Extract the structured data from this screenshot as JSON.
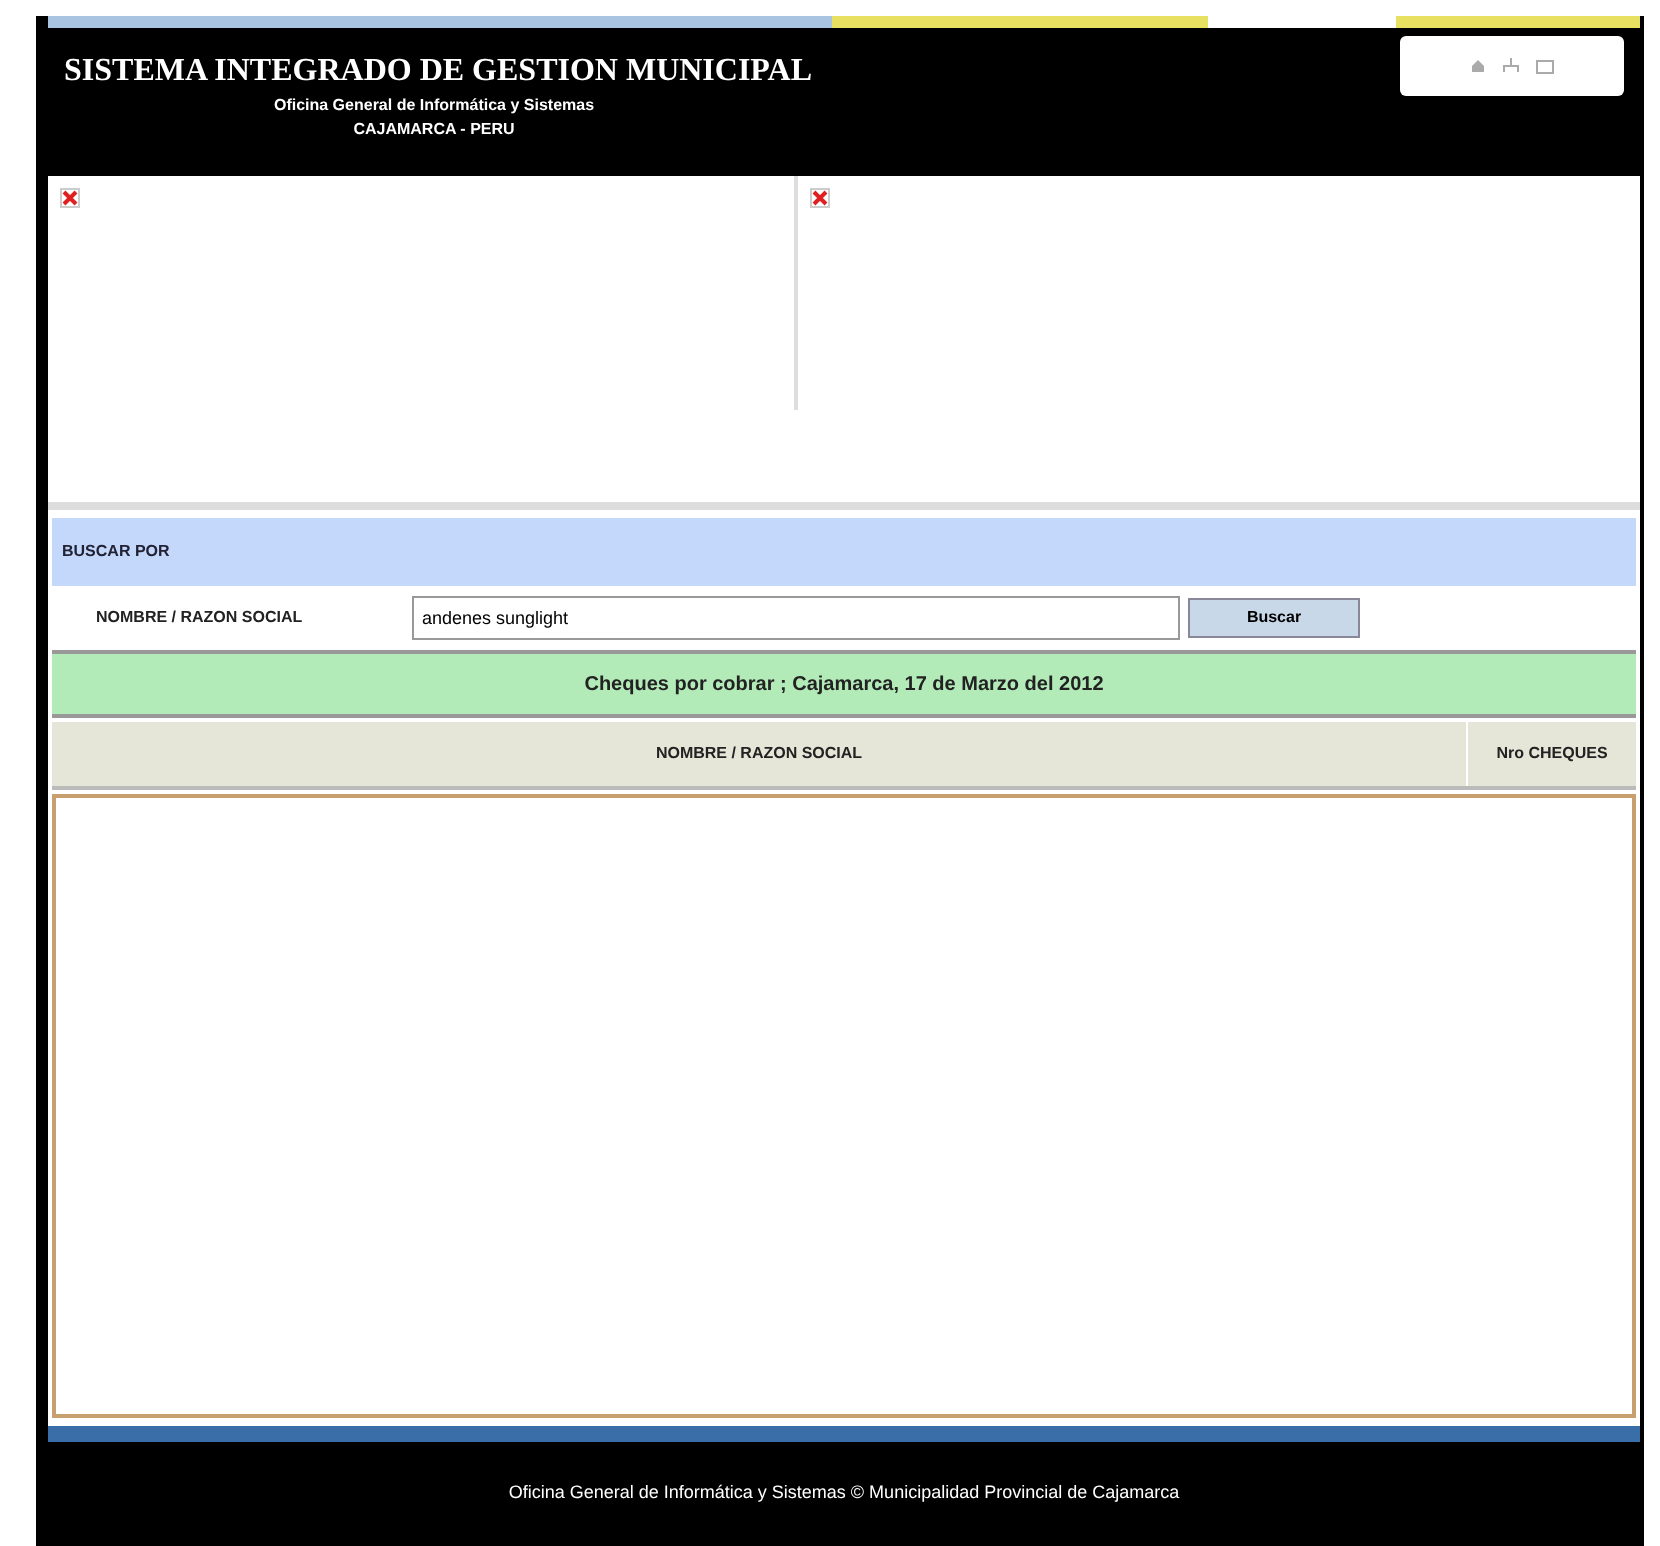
{
  "header": {
    "title": "SISTEMA INTEGRADO DE GESTION MUNICIPAL",
    "subtitle": "Oficina General de Informática y Sistemas",
    "location": "CAJAMARCA - PERU"
  },
  "search": {
    "heading": "BUSCAR POR",
    "label": "NOMBRE / RAZON SOCIAL",
    "value": "andenes sunglight",
    "button": "Buscar"
  },
  "banner": "Cheques por cobrar ; Cajamarca, 17 de Marzo del 2012",
  "table": {
    "columns": [
      "NOMBRE / RAZON SOCIAL",
      "Nro CHEQUES"
    ]
  },
  "footer": "Oficina General de Informática y Sistemas © Municipalidad Provincial de Cajamarca"
}
